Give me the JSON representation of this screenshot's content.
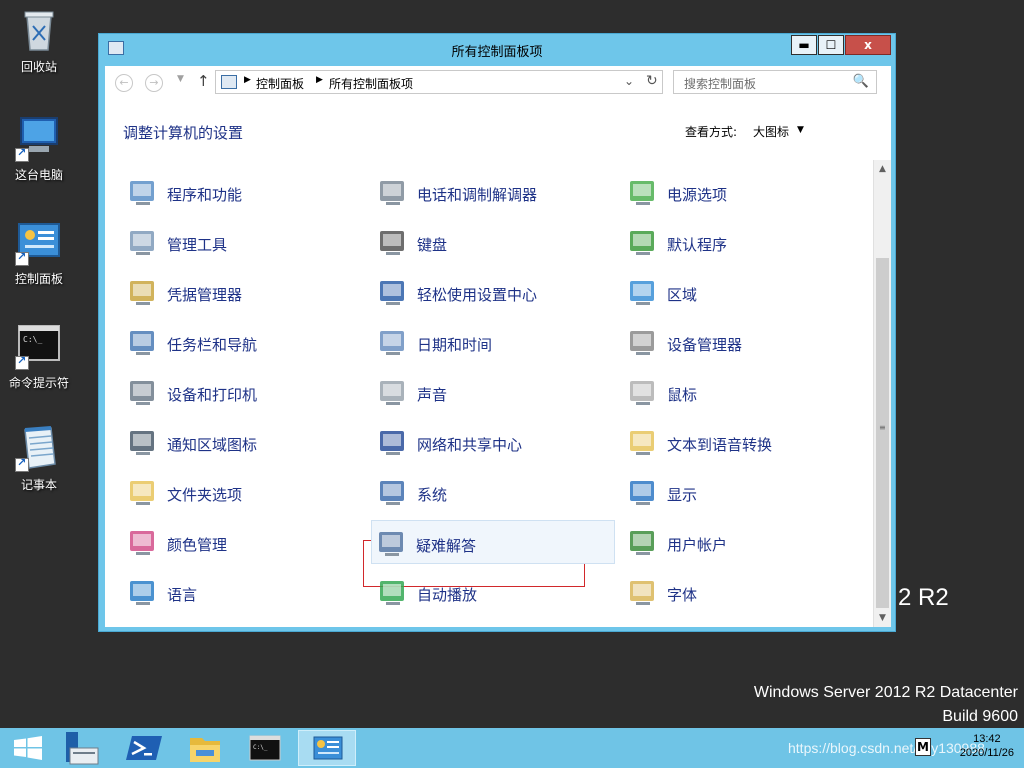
{
  "desktop": {
    "icons": [
      {
        "label": "回收站",
        "icon": "recycle-bin-icon"
      },
      {
        "label": "这台电脑",
        "icon": "this-pc-icon"
      },
      {
        "label": "控制面板",
        "icon": "control-panel-icon"
      },
      {
        "label": "命令提示符",
        "icon": "command-prompt-icon"
      },
      {
        "label": "记事本",
        "icon": "notepad-icon"
      }
    ],
    "watermark": {
      "r2": "2 R2",
      "line1": "Windows Server 2012 R2 Datacenter",
      "line2": "Build 9600"
    }
  },
  "window": {
    "title": "所有控制面板项",
    "buttons": {
      "minimize": "▬",
      "maximize": "☐",
      "close": "x"
    },
    "nav": {
      "back": "←",
      "forward": "→",
      "dropdown": "▼",
      "up": "↑",
      "breadcrumb": [
        "控制面板",
        "所有控制面板项"
      ],
      "breadcrumb_sep": "▶",
      "address_dropdown": "⌄",
      "refresh": "↻",
      "search_placeholder": "搜索控制面板",
      "search_icon": "🔍"
    },
    "heading": "调整计算机的设置",
    "view_by_label": "查看方式:",
    "view_by_value": "大图标",
    "view_by_arrow": "▼",
    "items": [
      {
        "label": "程序和功能",
        "icon": "programs-features-icon",
        "color": "#5a8fc7"
      },
      {
        "label": "电话和调制解调器",
        "icon": "phone-modem-icon",
        "color": "#7d8a96"
      },
      {
        "label": "电源选项",
        "icon": "power-options-icon",
        "color": "#4caf50"
      },
      {
        "label": "管理工具",
        "icon": "admin-tools-icon",
        "color": "#7e9ab8"
      },
      {
        "label": "键盘",
        "icon": "keyboard-icon",
        "color": "#555555"
      },
      {
        "label": "默认程序",
        "icon": "default-programs-icon",
        "color": "#3d9b3d"
      },
      {
        "label": "凭据管理器",
        "icon": "credential-manager-icon",
        "color": "#c9a640"
      },
      {
        "label": "轻松使用设置中心",
        "icon": "ease-of-access-icon",
        "color": "#2d5fa8"
      },
      {
        "label": "区域",
        "icon": "region-icon",
        "color": "#3a8fd6"
      },
      {
        "label": "任务栏和导航",
        "icon": "taskbar-navigation-icon",
        "color": "#4a7ab5"
      },
      {
        "label": "日期和时间",
        "icon": "date-time-icon",
        "color": "#6b8fbf"
      },
      {
        "label": "设备管理器",
        "icon": "device-manager-icon",
        "color": "#8a8a8a"
      },
      {
        "label": "设备和打印机",
        "icon": "devices-printers-icon",
        "color": "#6d7b8a"
      },
      {
        "label": "声音",
        "icon": "sound-icon",
        "color": "#9aa4ae"
      },
      {
        "label": "鼠标",
        "icon": "mouse-icon",
        "color": "#b0b0b0"
      },
      {
        "label": "通知区域图标",
        "icon": "notification-area-icon",
        "color": "#4a5b6b"
      },
      {
        "label": "网络和共享中心",
        "icon": "network-sharing-icon",
        "color": "#2a4f9a"
      },
      {
        "label": "文本到语音转换",
        "icon": "text-to-speech-icon",
        "color": "#e6c45c"
      },
      {
        "label": "文件夹选项",
        "icon": "folder-options-icon",
        "color": "#e8c45a"
      },
      {
        "label": "系统",
        "icon": "system-icon",
        "color": "#3f6fae"
      },
      {
        "label": "显示",
        "icon": "display-icon",
        "color": "#2f78c4"
      },
      {
        "label": "颜色管理",
        "icon": "color-management-icon",
        "color": "#d24f8a"
      },
      {
        "label": "疑难解答",
        "icon": "troubleshooting-icon",
        "color": "#5677a3"
      },
      {
        "label": "用户帐户",
        "icon": "user-accounts-icon",
        "color": "#3c8d3c"
      },
      {
        "label": "语言",
        "icon": "language-icon",
        "color": "#2b7fc8"
      },
      {
        "label": "自动播放",
        "icon": "autoplay-icon",
        "color": "#34a853"
      },
      {
        "label": "字体",
        "icon": "fonts-icon",
        "color": "#d9b658"
      }
    ],
    "highlighted_item": "系统",
    "hovered_item": "疑难解答",
    "scroll_arrows": {
      "up": "▲",
      "down": "▼",
      "grip": "≡"
    }
  },
  "taskbar": {
    "start_icon": "windows-start-icon",
    "apps": [
      {
        "name": "server-manager-icon"
      },
      {
        "name": "powershell-icon"
      },
      {
        "name": "file-explorer-icon"
      },
      {
        "name": "command-prompt-icon"
      },
      {
        "name": "control-panel-icon"
      }
    ],
    "tray_text": "https://blog.csdn.net/zyy130988",
    "tray_ime": "M",
    "time": "13:42",
    "date": "2020/11/26"
  },
  "colors": {
    "window_border": "#6ec6ea",
    "link_blue": "#1e3287",
    "highlight_red": "#d1282b",
    "taskbar": "#6fc4e6",
    "close_red": "#c7504a"
  }
}
